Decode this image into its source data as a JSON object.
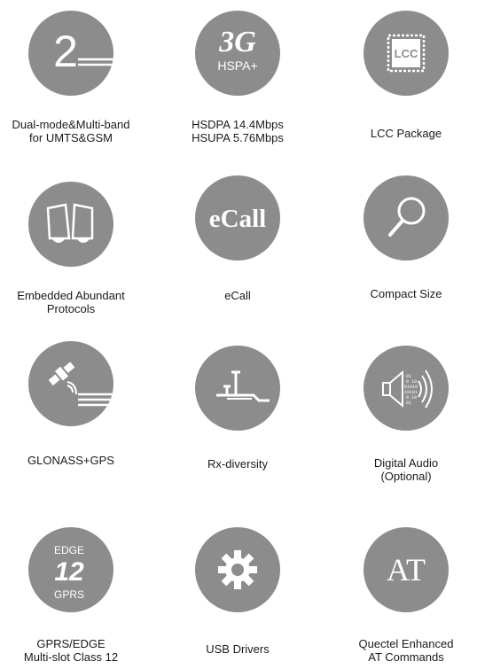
{
  "features": [
    {
      "icon": "two-lines-icon",
      "icon_text": "2",
      "lines": [
        "Dual-mode&Multi-band",
        "for UMTS&GSM"
      ]
    },
    {
      "icon": "3g-hspa-icon",
      "icon_text": "3G",
      "icon_subtext": "HSPA+",
      "lines": [
        "HSDPA 14.4Mbps",
        "HSUPA 5.76Mbps"
      ]
    },
    {
      "icon": "lcc-chip-icon",
      "icon_text": "LCC",
      "lines": [
        "LCC Package"
      ]
    },
    {
      "icon": "open-book-icon",
      "lines": [
        "Embedded Abundant",
        "Protocols"
      ]
    },
    {
      "icon": "ecall-icon",
      "icon_text": "eCall",
      "lines": [
        "eCall"
      ]
    },
    {
      "icon": "magnifier-icon",
      "lines": [
        "Compact  Size"
      ]
    },
    {
      "icon": "satellite-icon",
      "lines": [
        "GLONASS+GPS"
      ]
    },
    {
      "icon": "rx-diversity-icon",
      "lines": [
        "Rx-diversity"
      ]
    },
    {
      "icon": "speaker-icon",
      "icon_bits": [
        "01",
        "0 10",
        "01010",
        "10101",
        "0 10",
        "01"
      ],
      "lines": [
        "Digital Audio",
        "(Optional)"
      ]
    },
    {
      "icon": "edge-gprs-icon",
      "icon_text": "12",
      "icon_top": "EDGE",
      "icon_bottom": "GPRS",
      "lines": [
        "GPRS/EDGE",
        "Multi-slot  Class  12"
      ]
    },
    {
      "icon": "gear-icon",
      "lines": [
        "USB  Drivers"
      ]
    },
    {
      "icon": "at-commands-icon",
      "icon_text": "AT",
      "lines": [
        "Quectel Enhanced",
        "AT Commands"
      ]
    }
  ],
  "colors": {
    "circle": "#8c8c8c",
    "icon": "#ffffff",
    "text": "#1a1a1a"
  }
}
